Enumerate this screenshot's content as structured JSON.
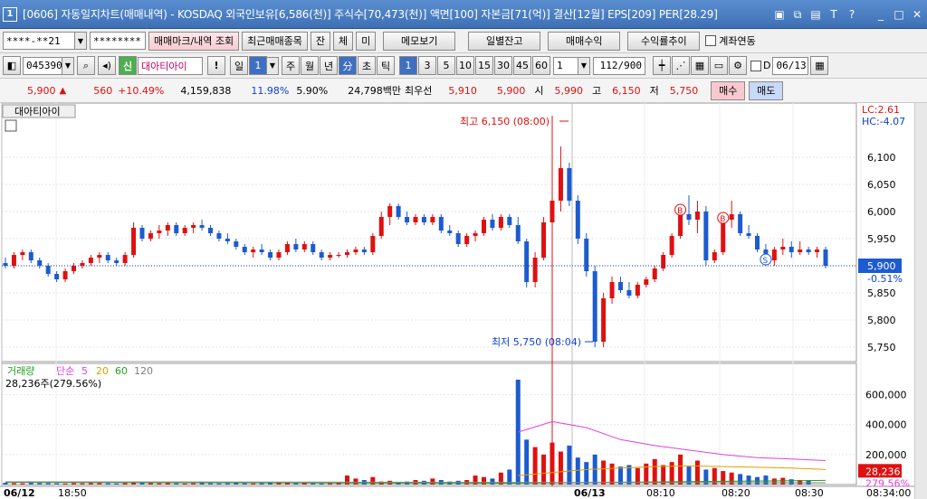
{
  "title_bar": {
    "window_number": "1",
    "title": "[0606] 자동일지차트(매매내역) - KOSDAQ 외국인보유[6,586(천)] 주식수[70,473(천)] 액면[100] 자본금[71(억)] 결산[12월] EPS[209] PER[28.29]",
    "icons": [
      "layout-icon",
      "restore-window-icon",
      "tile-icon",
      "text-icon",
      "help-icon",
      "minimize-icon",
      "maximize-icon",
      "close-icon"
    ]
  },
  "toolbar1": {
    "account": "****-**21",
    "password": "********",
    "trade_mark_button": "매매마크/내역 조회",
    "recent_items_button": "최근매매종목",
    "balance_button": "잔",
    "exec_button": "체",
    "unexec_button": "미",
    "memo_button": "메모보기",
    "daily_balance_button": "일별잔고",
    "trade_profit_button": "매매수익",
    "return_trend_button": "수익률추이",
    "account_link_label": "계좌연동"
  },
  "toolbar2": {
    "code": "045390",
    "credit_badge": "신",
    "stock_name": "대아티아이",
    "warning": "!",
    "day_label": "일",
    "day_value": "1",
    "periods": [
      "주",
      "월",
      "년",
      "分",
      "초",
      "틱"
    ],
    "intervals": [
      "1",
      "3",
      "5",
      "10",
      "15",
      "30",
      "45",
      "60"
    ],
    "count_value": "1",
    "range_value": "112/900",
    "d_label": "D",
    "date_value": "06/13"
  },
  "quote": {
    "price": "5,900",
    "change": "560",
    "change_pct": "+10.49%",
    "volume": "4,159,838",
    "vol_rate": "11.98%",
    "rate2": "5.90%",
    "amount": "24,798백만",
    "best_ask_label": "최우선",
    "best_ask": "5,910",
    "best_bid": "5,900",
    "open_label": "시",
    "open": "5,990",
    "high_label": "고",
    "high": "6,150",
    "low_label": "저",
    "low": "5,750",
    "buy_button": "매수",
    "sell_button": "매도"
  },
  "chart": {
    "legend_name": "대아티아이",
    "lc_label": "LC:2.61",
    "hc_label": "HC:-4.07",
    "high_annotation": "최고 6,150 (08:00)",
    "low_annotation": "최저 5,750 (08:04)",
    "current_price_tag": "5,900",
    "current_pct_tag": "-0.51%",
    "price_axis": [
      "6,100",
      "6,050",
      "6,000",
      "5,950",
      "5,900",
      "5,850",
      "5,800",
      "5,750"
    ],
    "volume_legend": "거래량",
    "ma_label": "단순",
    "ma_periods": [
      "5",
      "20",
      "60",
      "120"
    ],
    "volume_info": "28,236주(279.56%)",
    "volume_axis": [
      "600,000",
      "400,000",
      "200,000"
    ],
    "volume_tag": "28,236",
    "volume_pct_tag": "279.56%",
    "time_axis": [
      "06/12",
      "18:50",
      "06/13",
      "08:10",
      "08:20",
      "08:30",
      "08:34:00"
    ],
    "buy_mark": "B",
    "sell_mark": "S",
    "colors": {
      "up": "#e01010",
      "down": "#1c5bd0",
      "ma5": "#e040e0",
      "ma20": "#e0a000",
      "ma60": "#20a020",
      "ma120": "#808080"
    }
  },
  "chart_data": {
    "type": "candlestick",
    "price_ylim": [
      5730,
      6150
    ],
    "volume_ylim": [
      0,
      700000
    ],
    "candles": [
      {
        "o": 5905,
        "h": 5915,
        "l": 5895,
        "c": 5900
      },
      {
        "o": 5900,
        "h": 5925,
        "l": 5895,
        "c": 5920
      },
      {
        "o": 5920,
        "h": 5930,
        "l": 5910,
        "c": 5925
      },
      {
        "o": 5925,
        "h": 5930,
        "l": 5905,
        "c": 5910
      },
      {
        "o": 5910,
        "h": 5915,
        "l": 5895,
        "c": 5900
      },
      {
        "o": 5900,
        "h": 5905,
        "l": 5880,
        "c": 5885
      },
      {
        "o": 5885,
        "h": 5890,
        "l": 5870,
        "c": 5875
      },
      {
        "o": 5875,
        "h": 5895,
        "l": 5870,
        "c": 5890
      },
      {
        "o": 5890,
        "h": 5905,
        "l": 5885,
        "c": 5900
      },
      {
        "o": 5900,
        "h": 5910,
        "l": 5895,
        "c": 5905
      },
      {
        "o": 5905,
        "h": 5920,
        "l": 5900,
        "c": 5915
      },
      {
        "o": 5915,
        "h": 5925,
        "l": 5905,
        "c": 5920
      },
      {
        "o": 5920,
        "h": 5925,
        "l": 5905,
        "c": 5910
      },
      {
        "o": 5910,
        "h": 5915,
        "l": 5900,
        "c": 5905
      },
      {
        "o": 5905,
        "h": 5925,
        "l": 5900,
        "c": 5920
      },
      {
        "o": 5920,
        "h": 5980,
        "l": 5915,
        "c": 5970
      },
      {
        "o": 5970,
        "h": 5975,
        "l": 5945,
        "c": 5950
      },
      {
        "o": 5950,
        "h": 5965,
        "l": 5945,
        "c": 5960
      },
      {
        "o": 5960,
        "h": 5975,
        "l": 5950,
        "c": 5965
      },
      {
        "o": 5965,
        "h": 5980,
        "l": 5955,
        "c": 5975
      },
      {
        "o": 5975,
        "h": 5980,
        "l": 5955,
        "c": 5960
      },
      {
        "o": 5960,
        "h": 5975,
        "l": 5955,
        "c": 5970
      },
      {
        "o": 5970,
        "h": 5980,
        "l": 5960,
        "c": 5975
      },
      {
        "o": 5975,
        "h": 5985,
        "l": 5965,
        "c": 5970
      },
      {
        "o": 5970,
        "h": 5975,
        "l": 5955,
        "c": 5960
      },
      {
        "o": 5960,
        "h": 5965,
        "l": 5945,
        "c": 5950
      },
      {
        "o": 5950,
        "h": 5960,
        "l": 5940,
        "c": 5945
      },
      {
        "o": 5945,
        "h": 5950,
        "l": 5930,
        "c": 5935
      },
      {
        "o": 5935,
        "h": 5940,
        "l": 5920,
        "c": 5925
      },
      {
        "o": 5925,
        "h": 5935,
        "l": 5915,
        "c": 5930
      },
      {
        "o": 5930,
        "h": 5940,
        "l": 5920,
        "c": 5925
      },
      {
        "o": 5925,
        "h": 5930,
        "l": 5910,
        "c": 5915
      },
      {
        "o": 5915,
        "h": 5930,
        "l": 5910,
        "c": 5925
      },
      {
        "o": 5925,
        "h": 5945,
        "l": 5920,
        "c": 5940
      },
      {
        "o": 5940,
        "h": 5950,
        "l": 5925,
        "c": 5930
      },
      {
        "o": 5930,
        "h": 5945,
        "l": 5925,
        "c": 5940
      },
      {
        "o": 5940,
        "h": 5945,
        "l": 5920,
        "c": 5925
      },
      {
        "o": 5925,
        "h": 5930,
        "l": 5910,
        "c": 5915
      },
      {
        "o": 5915,
        "h": 5925,
        "l": 5910,
        "c": 5920
      },
      {
        "o": 5920,
        "h": 5925,
        "l": 5915,
        "c": 5920
      },
      {
        "o": 5920,
        "h": 5930,
        "l": 5915,
        "c": 5925
      },
      {
        "o": 5925,
        "h": 5935,
        "l": 5920,
        "c": 5930
      },
      {
        "o": 5930,
        "h": 5935,
        "l": 5920,
        "c": 5925
      },
      {
        "o": 5925,
        "h": 5960,
        "l": 5920,
        "c": 5955
      },
      {
        "o": 5955,
        "h": 6000,
        "l": 5950,
        "c": 5990
      },
      {
        "o": 5990,
        "h": 6015,
        "l": 5975,
        "c": 6010
      },
      {
        "o": 6010,
        "h": 6015,
        "l": 5985,
        "c": 5990
      },
      {
        "o": 5990,
        "h": 6000,
        "l": 5975,
        "c": 5980
      },
      {
        "o": 5980,
        "h": 5995,
        "l": 5975,
        "c": 5990
      },
      {
        "o": 5990,
        "h": 5995,
        "l": 5975,
        "c": 5980
      },
      {
        "o": 5980,
        "h": 5995,
        "l": 5975,
        "c": 5990
      },
      {
        "o": 5990,
        "h": 5995,
        "l": 5960,
        "c": 5965
      },
      {
        "o": 5965,
        "h": 5975,
        "l": 5955,
        "c": 5960
      },
      {
        "o": 5960,
        "h": 5965,
        "l": 5935,
        "c": 5940
      },
      {
        "o": 5940,
        "h": 5960,
        "l": 5935,
        "c": 5955
      },
      {
        "o": 5955,
        "h": 5965,
        "l": 5945,
        "c": 5960
      },
      {
        "o": 5960,
        "h": 5990,
        "l": 5955,
        "c": 5985
      },
      {
        "o": 5985,
        "h": 5995,
        "l": 5965,
        "c": 5970
      },
      {
        "o": 5970,
        "h": 5995,
        "l": 5965,
        "c": 5990
      },
      {
        "o": 5990,
        "h": 5995,
        "l": 5970,
        "c": 5975
      },
      {
        "o": 5975,
        "h": 5990,
        "l": 5940,
        "c": 5945
      },
      {
        "o": 5945,
        "h": 5950,
        "l": 5860,
        "c": 5870
      },
      {
        "o": 5870,
        "h": 5925,
        "l": 5860,
        "c": 5915
      },
      {
        "o": 5915,
        "h": 5990,
        "l": 5910,
        "c": 5980
      },
      {
        "o": 5980,
        "h": 6150,
        "l": 5975,
        "c": 6020
      },
      {
        "o": 6020,
        "h": 6120,
        "l": 6000,
        "c": 6080
      },
      {
        "o": 6080,
        "h": 6090,
        "l": 6010,
        "c": 6020
      },
      {
        "o": 6020,
        "h": 6030,
        "l": 5940,
        "c": 5950
      },
      {
        "o": 5950,
        "h": 5960,
        "l": 5880,
        "c": 5890
      },
      {
        "o": 5890,
        "h": 5900,
        "l": 5750,
        "c": 5760
      },
      {
        "o": 5760,
        "h": 5850,
        "l": 5750,
        "c": 5840
      },
      {
        "o": 5840,
        "h": 5880,
        "l": 5830,
        "c": 5870
      },
      {
        "o": 5870,
        "h": 5880,
        "l": 5850,
        "c": 5855
      },
      {
        "o": 5855,
        "h": 5870,
        "l": 5840,
        "c": 5845
      },
      {
        "o": 5845,
        "h": 5870,
        "l": 5840,
        "c": 5865
      },
      {
        "o": 5865,
        "h": 5880,
        "l": 5860,
        "c": 5875
      },
      {
        "o": 5875,
        "h": 5900,
        "l": 5870,
        "c": 5895
      },
      {
        "o": 5895,
        "h": 5925,
        "l": 5890,
        "c": 5920
      },
      {
        "o": 5920,
        "h": 5960,
        "l": 5915,
        "c": 5955
      },
      {
        "o": 5955,
        "h": 6010,
        "l": 5950,
        "c": 5995
      },
      {
        "o": 5995,
        "h": 6030,
        "l": 5975,
        "c": 5985
      },
      {
        "o": 5985,
        "h": 6020,
        "l": 5960,
        "c": 6000
      },
      {
        "o": 6000,
        "h": 6010,
        "l": 5900,
        "c": 5910
      },
      {
        "o": 5910,
        "h": 5930,
        "l": 5905,
        "c": 5925
      },
      {
        "o": 5925,
        "h": 5995,
        "l": 5920,
        "c": 5985
      },
      {
        "o": 5985,
        "h": 6020,
        "l": 5970,
        "c": 5995
      },
      {
        "o": 5995,
        "h": 6000,
        "l": 5955,
        "c": 5960
      },
      {
        "o": 5960,
        "h": 5975,
        "l": 5950,
        "c": 5955
      },
      {
        "o": 5955,
        "h": 5960,
        "l": 5925,
        "c": 5930
      },
      {
        "o": 5930,
        "h": 5940,
        "l": 5905,
        "c": 5910
      },
      {
        "o": 5910,
        "h": 5935,
        "l": 5900,
        "c": 5930
      },
      {
        "o": 5930,
        "h": 5950,
        "l": 5920,
        "c": 5935
      },
      {
        "o": 5935,
        "h": 5945,
        "l": 5915,
        "c": 5925
      },
      {
        "o": 5925,
        "h": 5945,
        "l": 5920,
        "c": 5930
      },
      {
        "o": 5930,
        "h": 5935,
        "l": 5920,
        "c": 5925
      },
      {
        "o": 5925,
        "h": 5935,
        "l": 5915,
        "c": 5930
      },
      {
        "o": 5930,
        "h": 5935,
        "l": 5895,
        "c": 5900
      }
    ],
    "volumes": [
      12000,
      9000,
      8000,
      11000,
      10000,
      9000,
      8000,
      7000,
      9000,
      8000,
      10000,
      9000,
      8000,
      7000,
      9000,
      14000,
      10000,
      9000,
      8000,
      9000,
      8000,
      7000,
      8000,
      9000,
      8000,
      7000,
      8000,
      9000,
      8000,
      7000,
      8000,
      9000,
      10000,
      9000,
      8000,
      9000,
      8000,
      7000,
      8000,
      9000,
      60000,
      40000,
      30000,
      50000,
      20000,
      25000,
      15000,
      20000,
      30000,
      25000,
      40000,
      30000,
      20000,
      25000,
      30000,
      60000,
      50000,
      40000,
      80000,
      100000,
      700000,
      300000,
      250000,
      200000,
      280000,
      220000,
      260000,
      180000,
      150000,
      200000,
      160000,
      140000,
      120000,
      130000,
      110000,
      140000,
      170000,
      130000,
      150000,
      200000,
      120000,
      160000,
      100000,
      110000,
      90000,
      80000,
      70000,
      60000,
      50000,
      60000,
      40000,
      45000,
      35000,
      30000,
      28236
    ],
    "ma5": [
      350000,
      420000,
      380000,
      300000,
      260000,
      230000,
      200000,
      180000,
      170000,
      160000
    ],
    "ma20": [
      60000,
      80000,
      100000,
      110000,
      120000,
      125000,
      120000,
      115000,
      110000,
      100000
    ],
    "annotations": [
      {
        "label": "최고 6,150 (08:00)",
        "value": 6150
      },
      {
        "label": "최저 5,750 (08:04)",
        "value": 5750
      }
    ]
  }
}
